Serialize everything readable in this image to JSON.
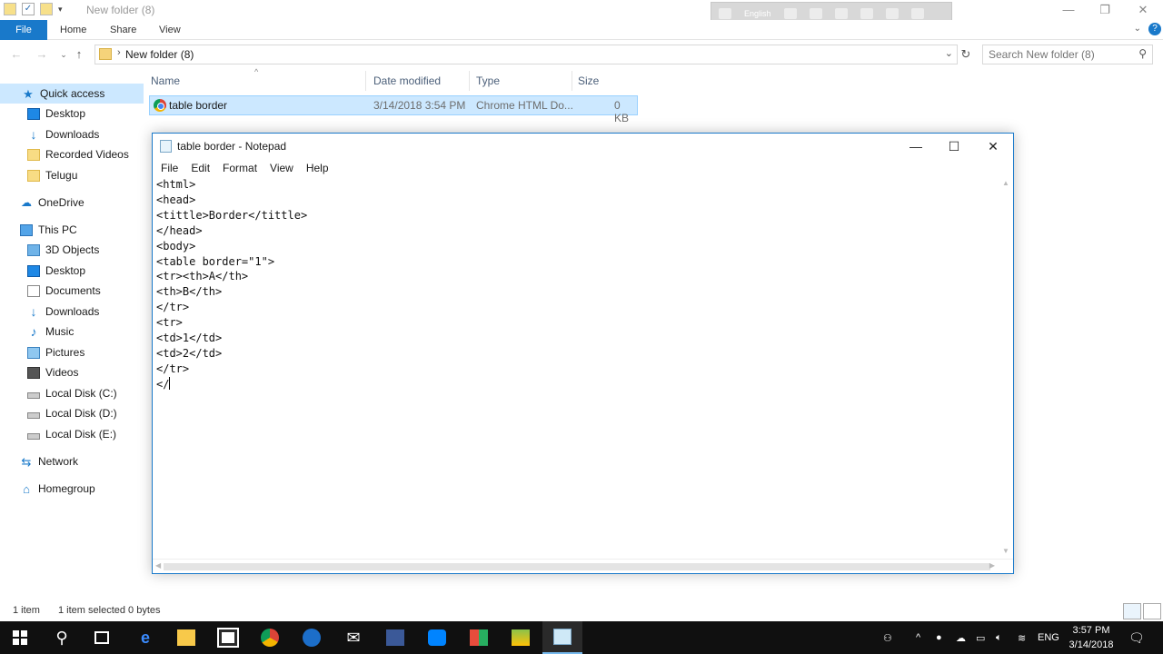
{
  "explorer": {
    "title": "New folder (8)",
    "ribbon_tabs": [
      "File",
      "Home",
      "Share",
      "View"
    ],
    "help_label": "?",
    "language_bar": {
      "label": "English"
    },
    "address": {
      "path": "New folder (8)"
    },
    "search": {
      "placeholder": "Search New folder (8)"
    },
    "sidebar": {
      "quick_access": "Quick access",
      "quick_items": [
        "Desktop",
        "Downloads",
        "Recorded Videos",
        "Telugu"
      ],
      "onedrive": "OneDrive",
      "this_pc": "This PC",
      "pc_items": [
        "3D Objects",
        "Desktop",
        "Documents",
        "Downloads",
        "Music",
        "Pictures",
        "Videos",
        "Local Disk (C:)",
        "Local Disk (D:)",
        "Local Disk (E:)"
      ],
      "network": "Network",
      "homegroup": "Homegroup"
    },
    "columns": [
      "Name",
      "Date modified",
      "Type",
      "Size"
    ],
    "files": [
      {
        "name": "table border",
        "date": "3/14/2018 3:54 PM",
        "type": "Chrome HTML Do...",
        "size": "0 KB"
      }
    ],
    "status": {
      "count": "1 item",
      "selected": "1 item selected  0 bytes"
    }
  },
  "notepad": {
    "title": "table border - Notepad",
    "menu": [
      "File",
      "Edit",
      "Format",
      "View",
      "Help"
    ],
    "content": "<html>\n<head>\n<tittle>Border</tittle>\n</head>\n<body>\n<table border=\"1\">\n<tr><th>A</th>\n<th>B</th>\n</tr>\n<tr>\n<td>1</td>\n<td>2</td>\n</tr>\n</"
  },
  "taskbar": {
    "language": "ENG",
    "time": "3:57 PM",
    "date": "3/14/2018",
    "apps": [
      "start-icon",
      "search-icon",
      "task-view-icon",
      "edge-icon",
      "file-explorer-icon",
      "store-icon",
      "chrome-icon",
      "imo-icon",
      "mail-icon",
      "facebook-icon",
      "messenger-icon",
      "office-icon",
      "bluestacks-icon",
      "notepad-icon"
    ]
  },
  "colors": {
    "accent": "#1979ca",
    "selection": "#cce8ff",
    "taskbar": "#101010"
  }
}
